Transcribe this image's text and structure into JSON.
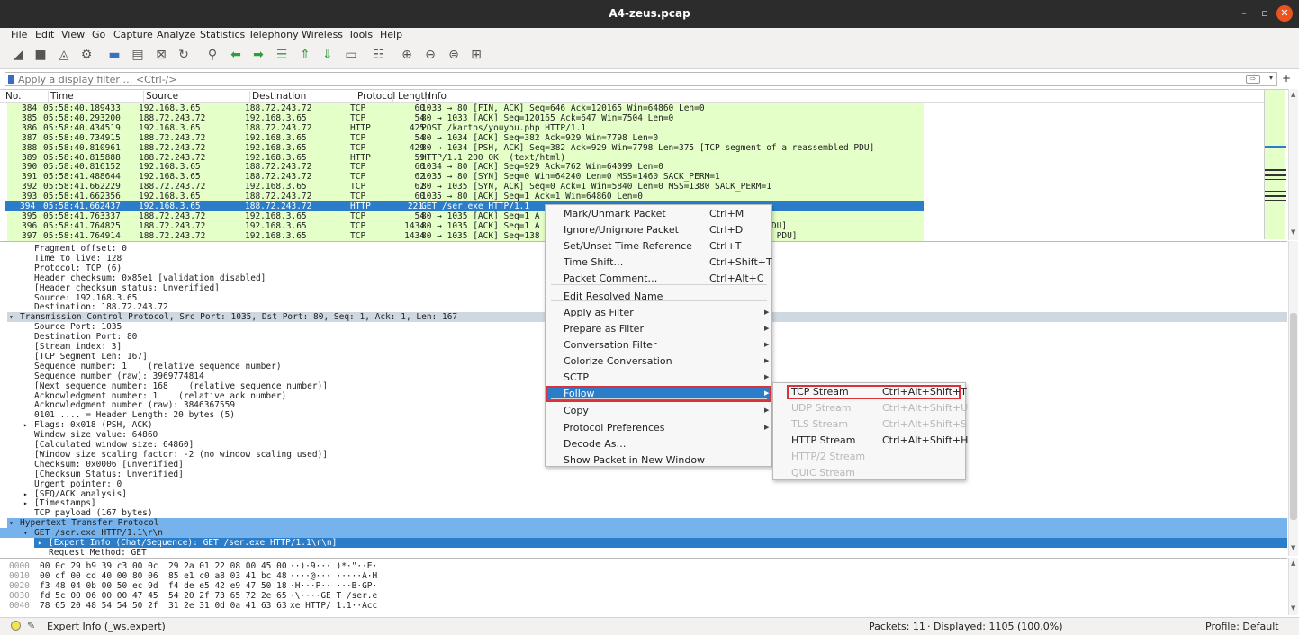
{
  "window": {
    "title": "A4-zeus.pcap",
    "controls": [
      "–",
      "▫",
      "✕"
    ]
  },
  "menubar": [
    "File",
    "Edit",
    "View",
    "Go",
    "Capture",
    "Analyze",
    "Statistics",
    "Telephony",
    "Wireless",
    "Tools",
    "Help"
  ],
  "toolbar": {
    "icons": [
      "shark-fin-start-icon",
      "stop-icon",
      "restart-icon",
      "capture-options-icon",
      "open-file-icon",
      "save-file-icon",
      "close-file-icon",
      "reload-icon",
      "find-icon",
      "back-arrow-icon",
      "forward-arrow-icon",
      "go-to-packet-icon",
      "first-packet-icon",
      "last-packet-icon",
      "autoscroll-icon",
      "colorize-icon",
      "zoom-in-icon",
      "zoom-out-icon",
      "zoom-normal-icon",
      "resize-columns-icon"
    ]
  },
  "filter": {
    "placeholder": "Apply a display filter … <Ctrl-/>",
    "plus": "+"
  },
  "packet_list": {
    "columns": [
      "No.",
      "Time",
      "Source",
      "Destination",
      "Protocol",
      "Length",
      "Info"
    ],
    "rows": [
      {
        "no": "384",
        "time": "05:58:40.189433",
        "src": "192.168.3.65",
        "dst": "188.72.243.72",
        "proto": "TCP",
        "len": "60",
        "info": "1033 → 80 [FIN, ACK] Seq=646 Ack=120165 Win=64860 Len=0"
      },
      {
        "no": "385",
        "time": "05:58:40.293200",
        "src": "188.72.243.72",
        "dst": "192.168.3.65",
        "proto": "TCP",
        "len": "54",
        "info": "80 → 1033 [ACK] Seq=120165 Ack=647 Win=7504 Len=0"
      },
      {
        "no": "386",
        "time": "05:58:40.434519",
        "src": "192.168.3.65",
        "dst": "188.72.243.72",
        "proto": "HTTP",
        "len": "425",
        "info": "POST /kartos/youyou.php HTTP/1.1"
      },
      {
        "no": "387",
        "time": "05:58:40.734915",
        "src": "188.72.243.72",
        "dst": "192.168.3.65",
        "proto": "TCP",
        "len": "54",
        "info": "80 → 1034 [ACK] Seq=382 Ack=929 Win=7798 Len=0"
      },
      {
        "no": "388",
        "time": "05:58:40.810961",
        "src": "188.72.243.72",
        "dst": "192.168.3.65",
        "proto": "TCP",
        "len": "429",
        "info": "80 → 1034 [PSH, ACK] Seq=382 Ack=929 Win=7798 Len=375 [TCP segment of a reassembled PDU]"
      },
      {
        "no": "389",
        "time": "05:58:40.815888",
        "src": "188.72.243.72",
        "dst": "192.168.3.65",
        "proto": "HTTP",
        "len": "59",
        "info": "HTTP/1.1 200 OK  (text/html)"
      },
      {
        "no": "390",
        "time": "05:58:40.816152",
        "src": "192.168.3.65",
        "dst": "188.72.243.72",
        "proto": "TCP",
        "len": "60",
        "info": "1034 → 80 [ACK] Seq=929 Ack=762 Win=64099 Len=0"
      },
      {
        "no": "391",
        "time": "05:58:41.488644",
        "src": "192.168.3.65",
        "dst": "188.72.243.72",
        "proto": "TCP",
        "len": "62",
        "info": "1035 → 80 [SYN] Seq=0 Win=64240 Len=0 MSS=1460 SACK_PERM=1"
      },
      {
        "no": "392",
        "time": "05:58:41.662229",
        "src": "188.72.243.72",
        "dst": "192.168.3.65",
        "proto": "TCP",
        "len": "62",
        "info": "80 → 1035 [SYN, ACK] Seq=0 Ack=1 Win=5840 Len=0 MSS=1380 SACK_PERM=1"
      },
      {
        "no": "393",
        "time": "05:58:41.662356",
        "src": "192.168.3.65",
        "dst": "188.72.243.72",
        "proto": "TCP",
        "len": "60",
        "info": "1035 → 80 [ACK] Seq=1 Ack=1 Win=64860 Len=0"
      },
      {
        "no": "394",
        "time": "05:58:41.662437",
        "src": "192.168.3.65",
        "dst": "188.72.243.72",
        "proto": "HTTP",
        "len": "221",
        "info": "GET /ser.exe HTTP/1.1"
      },
      {
        "no": "395",
        "time": "05:58:41.763337",
        "src": "188.72.243.72",
        "dst": "192.168.3.65",
        "proto": "TCP",
        "len": "54",
        "info": "80 → 1035 [ACK] Seq=1 A"
      },
      {
        "no": "396",
        "time": "05:58:41.764825",
        "src": "188.72.243.72",
        "dst": "192.168.3.65",
        "proto": "TCP",
        "len": "1434",
        "info": "80 → 1035 [ACK] Seq=1 A                                  assembled PDU]"
      },
      {
        "no": "397",
        "time": "05:58:41.764914",
        "src": "188.72.243.72",
        "dst": "192.168.3.65",
        "proto": "TCP",
        "len": "1434",
        "info": "80 → 1035 [ACK] Seq=138                                  reassembled PDU]"
      }
    ]
  },
  "details": [
    {
      "indent": 38,
      "arrow": "",
      "text": "Fragment offset: 0",
      "style": ""
    },
    {
      "indent": 38,
      "arrow": "",
      "text": "Time to live: 128",
      "style": ""
    },
    {
      "indent": 38,
      "arrow": "",
      "text": "Protocol: TCP (6)",
      "style": ""
    },
    {
      "indent": 38,
      "arrow": "",
      "text": "Header checksum: 0x85e1 [validation disabled]",
      "style": ""
    },
    {
      "indent": 38,
      "arrow": "",
      "text": "[Header checksum status: Unverified]",
      "style": ""
    },
    {
      "indent": 38,
      "arrow": "",
      "text": "Source: 192.168.3.65",
      "style": ""
    },
    {
      "indent": 38,
      "arrow": "",
      "text": "Destination: 188.72.243.72",
      "style": ""
    },
    {
      "indent": 22,
      "arrow": "▾",
      "text": "Transmission Control Protocol, Src Port: 1035, Dst Port: 80, Seq: 1, Ack: 1, Len: 167",
      "style": "hl"
    },
    {
      "indent": 38,
      "arrow": "",
      "text": "Source Port: 1035",
      "style": ""
    },
    {
      "indent": 38,
      "arrow": "",
      "text": "Destination Port: 80",
      "style": ""
    },
    {
      "indent": 38,
      "arrow": "",
      "text": "[Stream index: 3]",
      "style": ""
    },
    {
      "indent": 38,
      "arrow": "",
      "text": "[TCP Segment Len: 167]",
      "style": ""
    },
    {
      "indent": 38,
      "arrow": "",
      "text": "Sequence number: 1    (relative sequence number)",
      "style": ""
    },
    {
      "indent": 38,
      "arrow": "",
      "text": "Sequence number (raw): 3969774814",
      "style": ""
    },
    {
      "indent": 38,
      "arrow": "",
      "text": "[Next sequence number: 168    (relative sequence number)]",
      "style": ""
    },
    {
      "indent": 38,
      "arrow": "",
      "text": "Acknowledgment number: 1    (relative ack number)",
      "style": ""
    },
    {
      "indent": 38,
      "arrow": "",
      "text": "Acknowledgment number (raw): 3846367559",
      "style": ""
    },
    {
      "indent": 38,
      "arrow": "",
      "text": "0101 .... = Header Length: 20 bytes (5)",
      "style": ""
    },
    {
      "indent": 38,
      "arrow": "▸",
      "text": "Flags: 0x018 (PSH, ACK)",
      "style": ""
    },
    {
      "indent": 38,
      "arrow": "",
      "text": "Window size value: 64860",
      "style": ""
    },
    {
      "indent": 38,
      "arrow": "",
      "text": "[Calculated window size: 64860]",
      "style": ""
    },
    {
      "indent": 38,
      "arrow": "",
      "text": "[Window size scaling factor: -2 (no window scaling used)]",
      "style": ""
    },
    {
      "indent": 38,
      "arrow": "",
      "text": "Checksum: 0x0006 [unverified]",
      "style": ""
    },
    {
      "indent": 38,
      "arrow": "",
      "text": "[Checksum Status: Unverified]",
      "style": ""
    },
    {
      "indent": 38,
      "arrow": "",
      "text": "Urgent pointer: 0",
      "style": ""
    },
    {
      "indent": 38,
      "arrow": "▸",
      "text": "[SEQ/ACK analysis]",
      "style": ""
    },
    {
      "indent": 38,
      "arrow": "▸",
      "text": "[Timestamps]",
      "style": ""
    },
    {
      "indent": 38,
      "arrow": "",
      "text": "TCP payload (167 bytes)",
      "style": ""
    },
    {
      "indent": 22,
      "arrow": "▾",
      "text": "Hypertext Transfer Protocol",
      "style": "sel"
    },
    {
      "indent": 38,
      "arrow": "▾",
      "text": "GET /ser.exe HTTP/1.1\\r\\n",
      "style": "sel"
    },
    {
      "indent": 54,
      "arrow": "▸",
      "text": "[Expert Info (Chat/Sequence): GET /ser.exe HTTP/1.1\\r\\n]",
      "style": "sel2"
    },
    {
      "indent": 54,
      "arrow": "",
      "text": "Request Method: GET",
      "style": ""
    }
  ],
  "bytes": [
    {
      "off": "0000",
      "hex": "00 0c 29 b9 39 c3 00 0c  29 2a 01 22 08 00 45 00",
      "ascii": "··)·9··· )*·\"··E·"
    },
    {
      "off": "0010",
      "hex": "00 cf 00 cd 40 00 80 06  85 e1 c0 a8 03 41 bc 48",
      "ascii": "····@··· ·····A·H"
    },
    {
      "off": "0020",
      "hex": "f3 48 04 0b 00 50 ec 9d  f4 de e5 42 e9 47 50 18",
      "ascii": "·H···P·· ···B·GP·"
    },
    {
      "off": "0030",
      "hex": "fd 5c 00 06 00 00 47 45  54 20 2f 73 65 72 2e 65",
      "ascii": "·\\····GE T /ser.e"
    },
    {
      "off": "0040",
      "hex": "78 65 20 48 54 54 50 2f  31 2e 31 0d 0a 41 63 63",
      "ascii": "xe HTTP/ 1.1··Acc"
    }
  ],
  "status": {
    "expert": "Expert Info (_ws.expert)",
    "packets": "Packets: 11",
    "displayed": "· Displayed: 1105 (100.0%)",
    "profile": "Profile: Default"
  },
  "context_menu": {
    "items": [
      {
        "label": "Mark/Unmark Packet",
        "shortcut": "Ctrl+M",
        "sub": false
      },
      {
        "label": "Ignore/Unignore Packet",
        "shortcut": "Ctrl+D",
        "sub": false
      },
      {
        "label": "Set/Unset Time Reference",
        "shortcut": "Ctrl+T",
        "sub": false
      },
      {
        "label": "Time Shift…",
        "shortcut": "Ctrl+Shift+T",
        "sub": false
      },
      {
        "label": "Packet Comment…",
        "shortcut": "Ctrl+Alt+C",
        "sub": false
      },
      {
        "label": "Edit Resolved Name",
        "shortcut": "",
        "sub": false
      },
      {
        "label": "Apply as Filter",
        "shortcut": "",
        "sub": true
      },
      {
        "label": "Prepare as Filter",
        "shortcut": "",
        "sub": true
      },
      {
        "label": "Conversation Filter",
        "shortcut": "",
        "sub": true
      },
      {
        "label": "Colorize Conversation",
        "shortcut": "",
        "sub": true
      },
      {
        "label": "SCTP",
        "shortcut": "",
        "sub": true
      },
      {
        "label": "Follow",
        "shortcut": "",
        "sub": true
      },
      {
        "label": "Copy",
        "shortcut": "",
        "sub": true
      },
      {
        "label": "Protocol Preferences",
        "shortcut": "",
        "sub": true
      },
      {
        "label": "Decode As…",
        "shortcut": "",
        "sub": false
      },
      {
        "label": "Show Packet in New Window",
        "shortcut": "",
        "sub": false
      }
    ]
  },
  "follow_submenu": {
    "items": [
      {
        "label": "TCP Stream",
        "shortcut": "Ctrl+Alt+Shift+T",
        "disabled": false
      },
      {
        "label": "UDP Stream",
        "shortcut": "Ctrl+Alt+Shift+U",
        "disabled": true
      },
      {
        "label": "TLS Stream",
        "shortcut": "Ctrl+Alt+Shift+S",
        "disabled": true
      },
      {
        "label": "HTTP Stream",
        "shortcut": "Ctrl+Alt+Shift+H",
        "disabled": false
      },
      {
        "label": "HTTP/2 Stream",
        "shortcut": "",
        "disabled": true
      },
      {
        "label": "QUIC Stream",
        "shortcut": "",
        "disabled": true
      }
    ]
  }
}
